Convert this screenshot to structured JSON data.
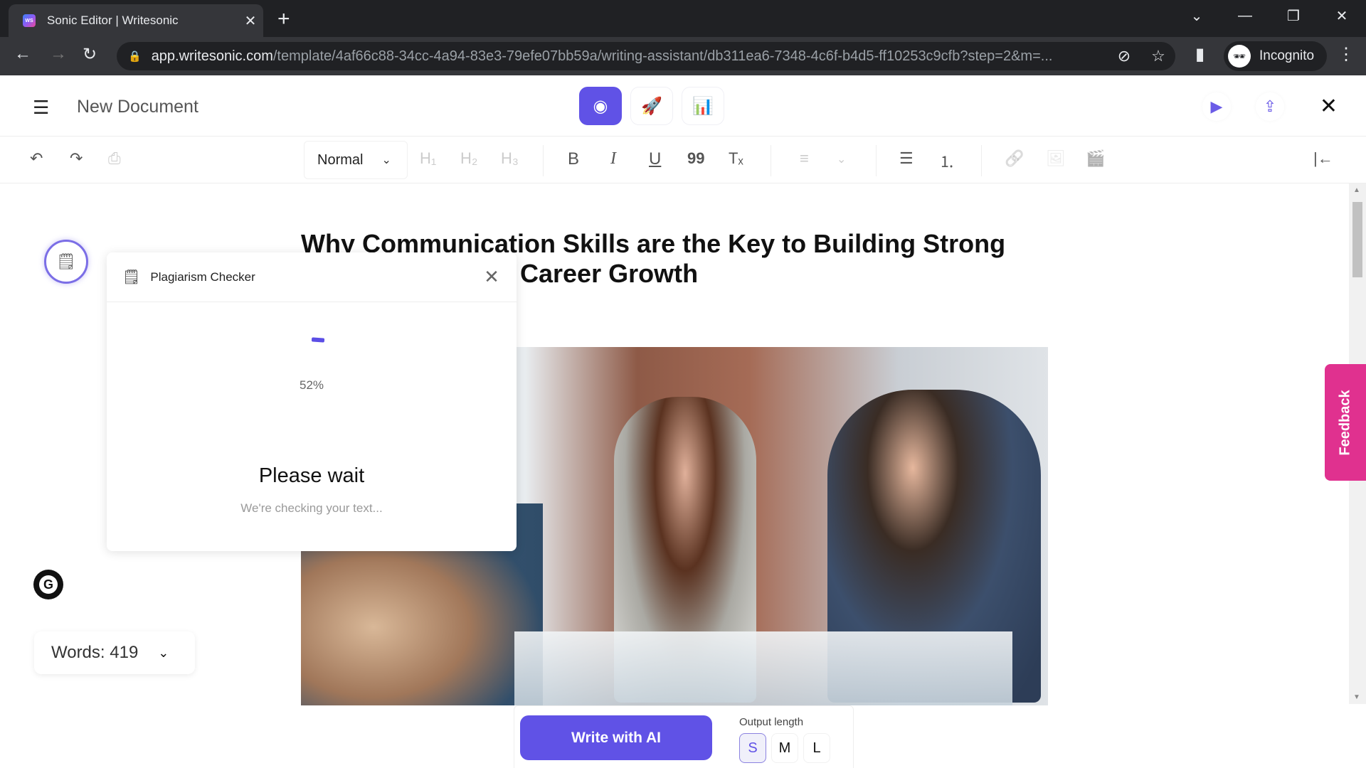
{
  "browser": {
    "tab_title": "Sonic Editor | Writesonic",
    "tab_favicon": "WS",
    "tab_close": "✕",
    "new_tab": "+",
    "url_host": "app.writesonic.com",
    "url_path": "/template/4af66c88-34cc-4a94-83e3-79efe07bb59a/writing-assistant/db311ea6-7348-4c6f-b4d5-ff10253c9cfb?step=2&m=...",
    "profile_label": "Incognito",
    "icons": {
      "back": "←",
      "forward": "→",
      "reload": "↻",
      "lock": "🔒",
      "eye_off": "⊘",
      "star": "☆",
      "sidebar": "▮",
      "menu": "⋮",
      "tab_list": "⌄",
      "minimize": "—",
      "restore": "❐",
      "close": "✕"
    }
  },
  "header": {
    "menu_icon": "☰",
    "doc_title": "New Document",
    "modes": [
      {
        "name": "preview",
        "icon": "◉",
        "active": true
      },
      {
        "name": "launch",
        "icon": "🚀",
        "active": false
      },
      {
        "name": "presentation",
        "icon": "📊",
        "active": false
      }
    ],
    "play_icon": "▶",
    "share_icon": "⇪",
    "close_icon": "✕"
  },
  "toolbar": {
    "undo": "↶",
    "redo": "↷",
    "print": "⎙",
    "style_value": "Normal",
    "style_chevron": "⌄",
    "h1": "H₁",
    "h2": "H₂",
    "h3": "H₃",
    "bold": "B",
    "italic": "I",
    "underline": "U",
    "quote": "99",
    "clear_format": "Tₓ",
    "align": "≡",
    "align_chevron": "⌄",
    "bullet_list": "☰",
    "numbered_list": "⒈",
    "link": "🔗",
    "image": "🖼",
    "video": "🎬",
    "collapse": "|←"
  },
  "document": {
    "title_line1": "Why Communication Skills are the Key to Building Strong",
    "title_line2": "Career Growth",
    "image_alt": "Business people meeting at a table"
  },
  "plagiarism": {
    "side_icon": "🗒",
    "title": "Plagiarism Checker",
    "close": "✕",
    "progress_percent": 52,
    "progress_label": "52%",
    "heading": "Please wait",
    "subtext": "We're checking your text..."
  },
  "sidebar_left": {
    "grammarly_icon": "G",
    "words_label": "Words: 419",
    "words_chevron": "⌄"
  },
  "bottom": {
    "write_button": "Write with AI",
    "output_length_label": "Output length",
    "sizes": [
      {
        "label": "S",
        "selected": true
      },
      {
        "label": "M",
        "selected": false
      },
      {
        "label": "L",
        "selected": false
      }
    ]
  },
  "feedback_label": "Feedback",
  "colors": {
    "accent": "#6052e6",
    "feedback": "#e0318f"
  }
}
